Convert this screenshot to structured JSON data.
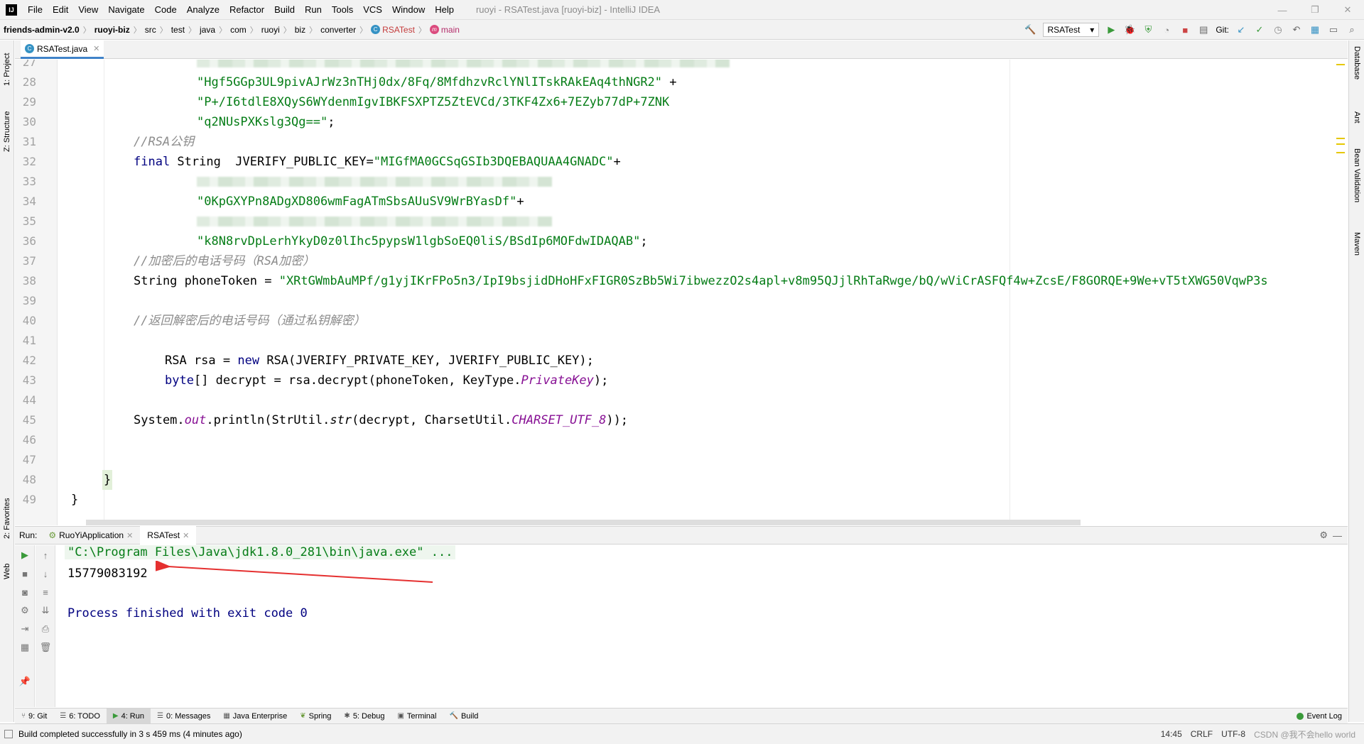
{
  "menubar": {
    "items": [
      "File",
      "Edit",
      "View",
      "Navigate",
      "Code",
      "Analyze",
      "Refactor",
      "Build",
      "Run",
      "Tools",
      "VCS",
      "Window",
      "Help"
    ],
    "window_title": "ruoyi - RSATest.java [ruoyi-biz] - IntelliJ IDEA"
  },
  "breadcrumb": [
    "friends-admin-v2.0",
    "ruoyi-biz",
    "src",
    "test",
    "java",
    "com",
    "ruoyi",
    "biz",
    "converter",
    "RSATest",
    "main"
  ],
  "toolbar": {
    "run_config": "RSATest",
    "git_label": "Git:"
  },
  "left_strip": {
    "project": "1: Project",
    "structure": "Z: Structure",
    "favorites": "2: Favorites",
    "web": "Web"
  },
  "right_strip": {
    "database": "Database",
    "ant": "Ant",
    "bean_validation": "Bean Validation",
    "maven": "Maven"
  },
  "editor_tab": {
    "filename": "RSATest.java"
  },
  "editor": {
    "line_numbers": [
      "27",
      "28",
      "29",
      "30",
      "31",
      "32",
      "33",
      "34",
      "35",
      "36",
      "37",
      "38",
      "39",
      "40",
      "41",
      "42",
      "43",
      "44",
      "45",
      "46",
      "47",
      "48",
      "49"
    ],
    "l28_str": "\"Hgf5GGp3UL9pivAJrWz3nTHj0dx/8Fq/8MfdhzvRclYNlITskRAkEAq4thNGR2\"",
    "l28_plus": " +",
    "l29_str": "\"P+/I6tdlE8XQyS6WYdenmIgvIBKFSXPTZ5ZtEVCd/3TKF4Zx6+7EZyb77dP+7ZNK",
    "l30_str": "\"q2NUsPXKslg3Qg==\"",
    "l30_end": ";",
    "l31_comment": "//RSA公钥",
    "l32_kw": "final",
    "l32_mid": " String  JVERIFY_PUBLIC_KEY=",
    "l32_str": "\"MIGfMA0GCSqGSIb3DQEBAQUAA4GNADC\"",
    "l32_plus": "+",
    "l34_str": "\"0KpGXYPn8ADgXD806wmFagATmSbsAUuSV9WrBYasDf\"",
    "l34_plus": "+",
    "l36_str": "\"k8N8rvDpLerhYkyD0z0lIhc5pypsW1lgbSoEQ0liS/BSdIp6MOFdwIDAQAB\"",
    "l36_end": ";",
    "l37_comment": "//加密后的电话号码（RSA加密）",
    "l38_pre": "String phoneToken = ",
    "l38_str": "\"XRtGWmbAuMPf/g1yjIKrFPo5n3/IpI9bsjidDHoHFxFIGR0SzBb5Wi7ibwezzO2s4apl+v8m95QJjlRhTaRwge/bQ/wViCrASFQf4w+ZcsE/F8GORQE+9We+vT5tXWG50VqwP3s",
    "l40_comment": "//返回解密后的电话号码（通过私钥解密）",
    "l42_pre": "RSA rsa = ",
    "l42_kw": "new",
    "l42_post": " RSA(JVERIFY_PRIVATE_KEY, JVERIFY_PUBLIC_KEY);",
    "l43_kw": "byte",
    "l43_mid": "[] decrypt = rsa.decrypt(phoneToken, KeyType.",
    "l43_it": "PrivateKey",
    "l43_end": ");",
    "l45_pre": "System.",
    "l45_out": "out",
    "l45_mid": ".println(StrUtil.",
    "l45_str": "str",
    "l45_mid2": "(decrypt, CharsetUtil.",
    "l45_const": "CHARSET_UTF_8",
    "l45_end": "));",
    "l48_brace": "}",
    "l49_brace": "}"
  },
  "run_panel": {
    "label": "Run:",
    "tabs": [
      "RuoYiApplication",
      "RSATest"
    ],
    "console": {
      "command": "\"C:\\Program Files\\Java\\jdk1.8.0_281\\bin\\java.exe\" ...",
      "output": "15779083192",
      "finished": "Process finished with exit code 0"
    }
  },
  "bottom_tabs": [
    "9: Git",
    "6: TODO",
    "4: Run",
    "0: Messages",
    "Java Enterprise",
    "Spring",
    "5: Debug",
    "Terminal",
    "Build"
  ],
  "event_log": "Event Log",
  "status": {
    "message": "Build completed successfully in 3 s 459 ms (4 minutes ago)",
    "time": "14:45",
    "line_sep": "CRLF",
    "encoding": "UTF-8",
    "watermark": "CSDN @我不会hello world"
  },
  "colors": {
    "accent": "#4083c9",
    "string": "#067d17",
    "keyword": "#000080",
    "arrow": "#e53030"
  }
}
